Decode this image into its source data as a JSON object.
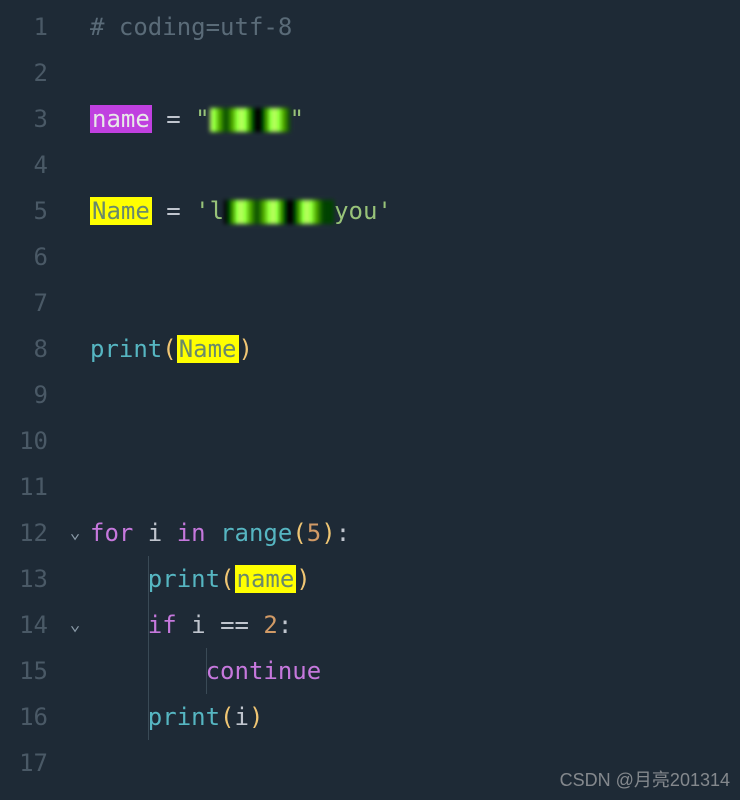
{
  "lines": {
    "1": "1",
    "2": "2",
    "3": "3",
    "4": "4",
    "5": "5",
    "6": "6",
    "7": "7",
    "8": "8",
    "9": "9",
    "10": "10",
    "11": "11",
    "12": "12",
    "13": "13",
    "14": "14",
    "15": "15",
    "16": "16",
    "17": "17"
  },
  "fold": {
    "down": "⌄"
  },
  "code": {
    "l1": {
      "comment": "# coding=utf-8"
    },
    "l3": {
      "name": "name",
      "eq": " = ",
      "q1": "\"",
      "q2": "\""
    },
    "l5": {
      "name": "Name",
      "eq": " = ",
      "q1": "'l",
      "you": "you",
      "q2": "'"
    },
    "l8": {
      "print": "print",
      "lp": "(",
      "name": "Name",
      "rp": ")"
    },
    "l12": {
      "for": "for",
      "i": " i ",
      "in": "in",
      "sp": " ",
      "range": "range",
      "lp": "(",
      "n": "5",
      "rp": ")",
      "colon": ":"
    },
    "l13": {
      "print": "print",
      "lp": "(",
      "name": "name",
      "rp": ")"
    },
    "l14": {
      "if": "if",
      "cond": " i ",
      "eq": "==",
      "sp": " ",
      "n": "2",
      "colon": ":"
    },
    "l15": {
      "continue": "continue"
    },
    "l16": {
      "print": "print",
      "lp": "(",
      "i": "i",
      "rp": ")"
    }
  },
  "watermark": "CSDN @月亮201314"
}
